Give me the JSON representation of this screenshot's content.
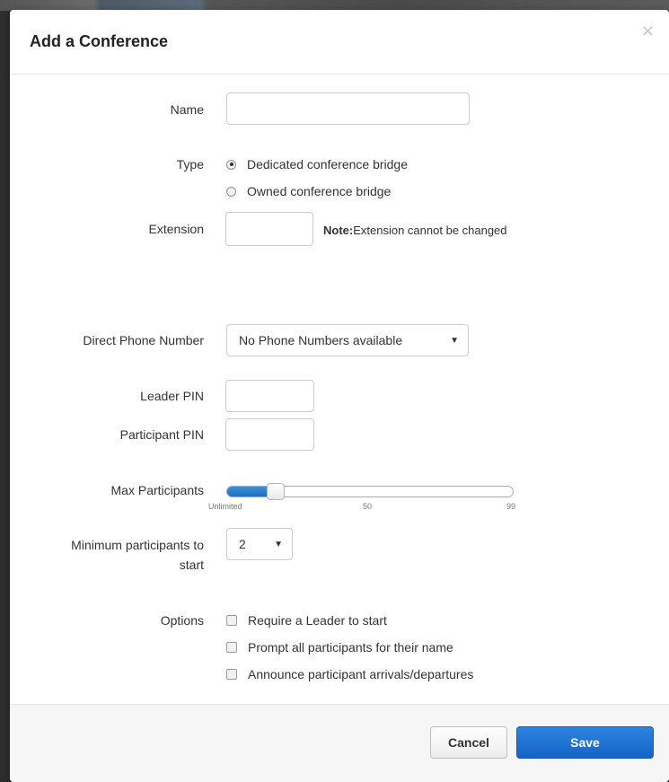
{
  "dialog": {
    "title": "Add a Conference",
    "close_glyph": "×"
  },
  "form": {
    "name": {
      "label": "Name",
      "value": ""
    },
    "type": {
      "label": "Type",
      "options": [
        {
          "label": "Dedicated conference bridge",
          "checked": true
        },
        {
          "label": "Owned conference bridge",
          "checked": false
        }
      ]
    },
    "extension": {
      "label": "Extension",
      "value": "",
      "note_prefix": "Note:",
      "note_text": "Extension cannot be changed"
    },
    "direct_phone": {
      "label": "Direct Phone Number",
      "selected": "No Phone Numbers available"
    },
    "leader_pin": {
      "label": "Leader PIN",
      "value": ""
    },
    "participant_pin": {
      "label": "Participant PIN",
      "value": ""
    },
    "max_participants": {
      "label": "Max Participants",
      "ticks": [
        "Unlimited",
        "50",
        "99"
      ],
      "fraction": 0.17
    },
    "min_participants": {
      "label_line1": "Minimum participants to",
      "label_line2": "start",
      "selected": "2"
    },
    "options": {
      "label": "Options",
      "items": [
        {
          "label": "Require a Leader to start",
          "checked": false
        },
        {
          "label": "Prompt all participants for their name",
          "checked": false
        },
        {
          "label": "Announce participant arrivals/departures",
          "checked": false
        }
      ]
    }
  },
  "footer": {
    "cancel_label": "Cancel",
    "save_label": "Save"
  },
  "colors": {
    "primary": "#1a6fd0",
    "slider_fill": "#2a7fd4"
  },
  "icons": {
    "close": "close-icon",
    "dropdown": "caret-down-icon"
  }
}
